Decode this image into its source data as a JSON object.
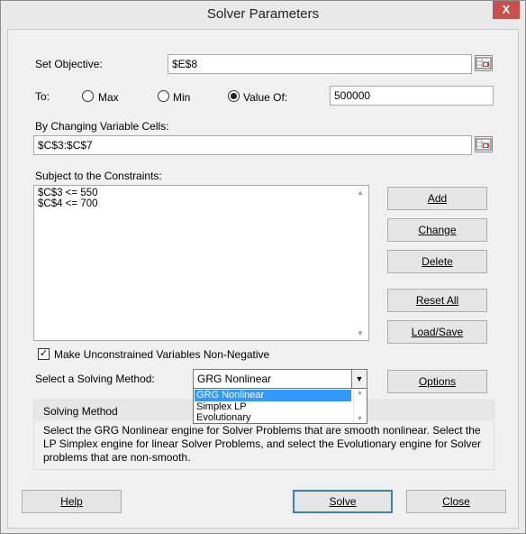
{
  "window": {
    "title": "Solver Parameters",
    "close_glyph": "X"
  },
  "objective": {
    "label": "Set Objective:",
    "value": "$E$8"
  },
  "to": {
    "label": "To:",
    "max_label": "Max",
    "min_label": "Min",
    "value_of_label": "Value Of:",
    "selected": "Value Of:",
    "value": "500000"
  },
  "changing": {
    "label": "By Changing Variable Cells:",
    "value": "$C$3:$C$7"
  },
  "constraints": {
    "label": "Subject to the Constraints:",
    "items": [
      "$C$3 <= 550",
      "$C$4 <= 700"
    ]
  },
  "buttons": {
    "add": "Add",
    "change": "Change",
    "delete": "Delete",
    "reset_all": "Reset All",
    "load_save": "Load/Save",
    "options": "Options",
    "help": "Help",
    "solve": "Solve",
    "close": "Close"
  },
  "nonneg": {
    "label": "Make Unconstrained Variables Non-Negative",
    "checked": true
  },
  "method": {
    "label": "Select a Solving Method:",
    "selected": "GRG Nonlinear",
    "options": [
      "GRG Nonlinear",
      "Simplex LP",
      "Evolutionary"
    ]
  },
  "solving_method": {
    "heading": "Solving Method",
    "description": "Select the GRG Nonlinear engine for Solver Problems that are smooth nonlinear. Select the LP Simplex engine for linear Solver Problems, and select the Evolutionary engine for Solver problems that are non-smooth."
  },
  "colors": {
    "close_red": "#c7504f",
    "selection_blue": "#3399ff",
    "default_border": "#3c7fb1"
  },
  "icons": {
    "ref": "range-selector-icon",
    "check": "checkmark-icon",
    "chevron": "chevron-down-icon"
  }
}
